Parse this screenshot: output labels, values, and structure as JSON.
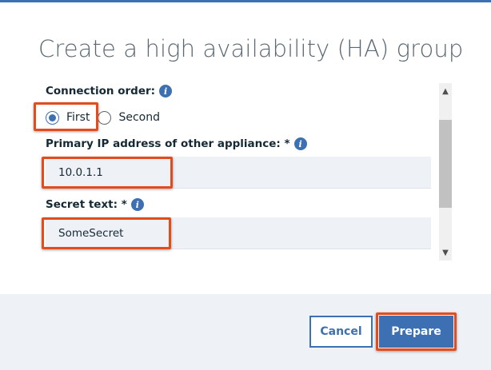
{
  "dialog": {
    "title": "Create a high availability (HA) group"
  },
  "form": {
    "connection_order": {
      "label": "Connection order:",
      "options": [
        "First",
        "Second"
      ],
      "selected": "First"
    },
    "primary_ip": {
      "label": "Primary IP address of other appliance: *",
      "value": "10.0.1.1"
    },
    "secret_text": {
      "label": "Secret text: *",
      "value": "SomeSecret"
    }
  },
  "icons": {
    "info": "i",
    "scroll_up": "▲",
    "scroll_down": "▼"
  },
  "buttons": {
    "cancel": "Cancel",
    "prepare": "Prepare"
  },
  "colors": {
    "primary": "#3d70b2",
    "highlight": "#e34c1d",
    "field_bg": "#eef1f6"
  }
}
